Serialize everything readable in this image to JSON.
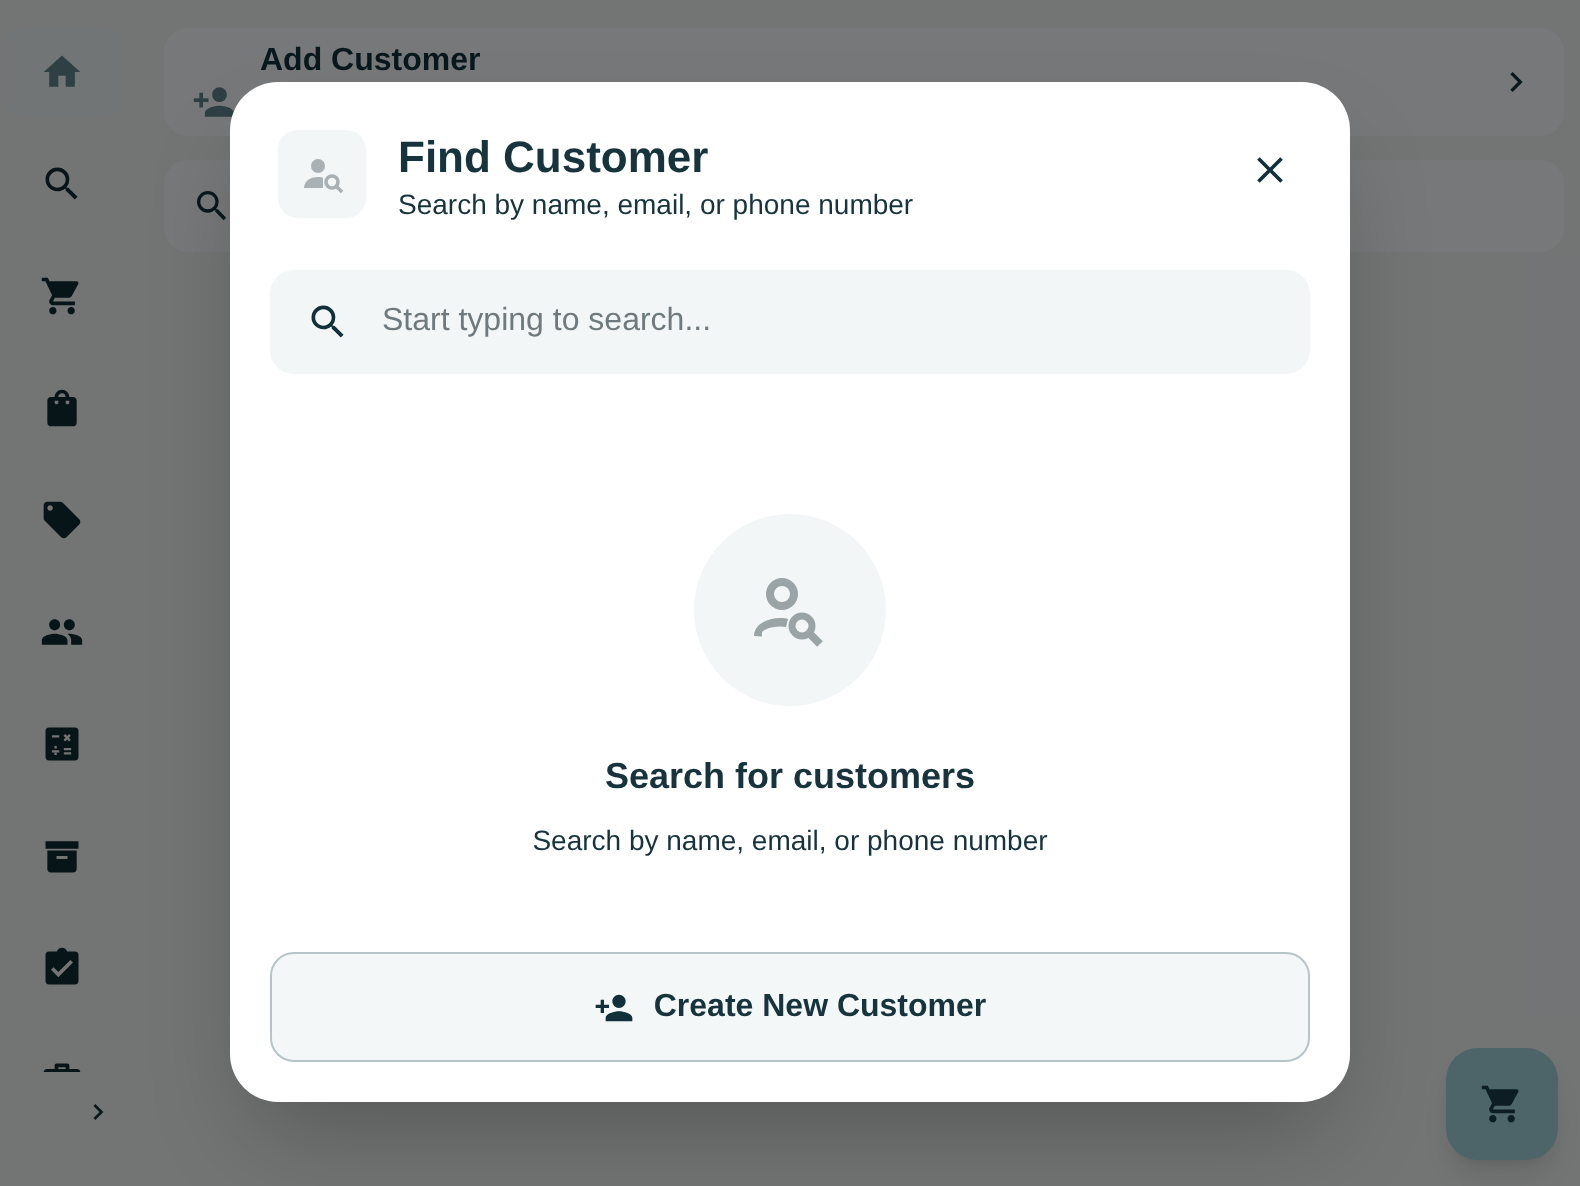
{
  "sidebar": {
    "items": [
      {
        "selected": true
      },
      {
        "selected": false
      },
      {
        "selected": false
      },
      {
        "selected": false
      },
      {
        "selected": false
      },
      {
        "selected": false
      },
      {
        "selected": false
      },
      {
        "selected": false
      },
      {
        "selected": false
      },
      {
        "selected": false
      }
    ]
  },
  "background": {
    "add_customer_card": {
      "title": "Add Customer"
    }
  },
  "dialog": {
    "title": "Find Customer",
    "subtitle": "Search by name, email, or phone number",
    "search": {
      "placeholder": "Start typing to search..."
    },
    "empty_state": {
      "title": "Search for customers",
      "text": "Search by name, email, or phone number"
    },
    "create_button": {
      "label": "Create New Customer"
    }
  }
}
